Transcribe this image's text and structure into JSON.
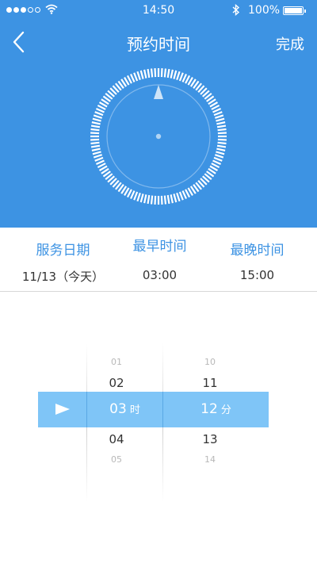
{
  "status": {
    "time": "14:50",
    "battery": "100%"
  },
  "nav": {
    "title": "预约时间",
    "done": "完成"
  },
  "info": {
    "service_date": {
      "label": "服务日期",
      "value": "11/13（今天）"
    },
    "earliest": {
      "label": "最早时间",
      "value": "03:00"
    },
    "latest": {
      "label": "最晚时间",
      "value": "15:00"
    }
  },
  "picker": {
    "hours": [
      "01",
      "02",
      "03",
      "04",
      "05"
    ],
    "minutes": [
      "10",
      "11",
      "12",
      "13",
      "14"
    ],
    "hour_unit": "时",
    "minute_unit": "分"
  },
  "colors": {
    "accent": "#3d93e3",
    "highlight": "#7fc5f7"
  }
}
